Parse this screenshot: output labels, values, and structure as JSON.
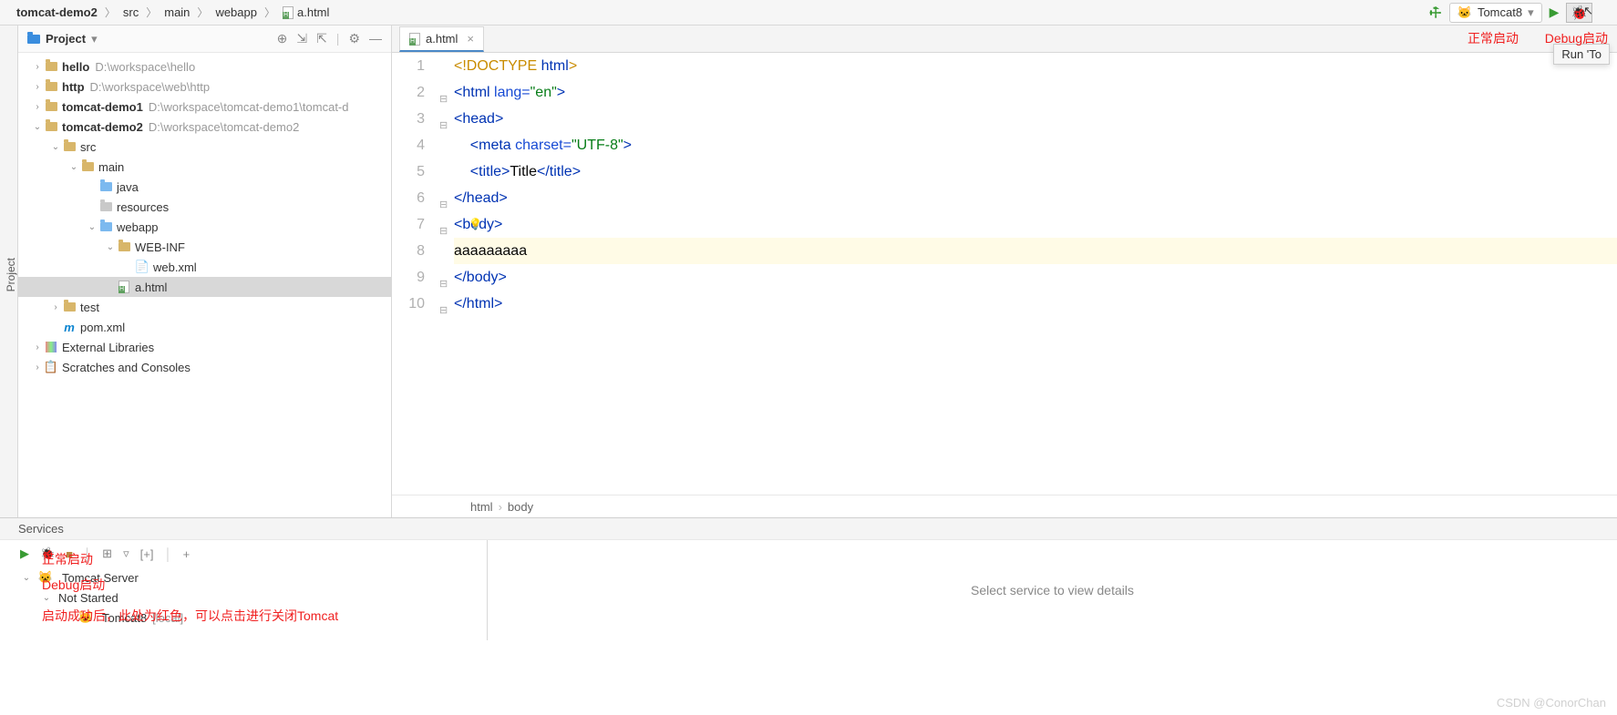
{
  "breadcrumbs": [
    {
      "label": "tomcat-demo2",
      "bold": true
    },
    {
      "label": "src"
    },
    {
      "label": "main"
    },
    {
      "label": "webapp"
    },
    {
      "label": "a.html",
      "icon": "html"
    }
  ],
  "toolbar": {
    "run_config": "Tomcat8",
    "tooltip": "Run 'To"
  },
  "left_gutter": "Project",
  "project_panel": {
    "title": "Project",
    "tree": [
      {
        "indent": 0,
        "arrow": "›",
        "icon": "folder",
        "name": "hello",
        "bold": true,
        "path": "D:\\workspace\\hello"
      },
      {
        "indent": 0,
        "arrow": "›",
        "icon": "folder",
        "name": "http",
        "bold": true,
        "path": "D:\\workspace\\web\\http"
      },
      {
        "indent": 0,
        "arrow": "›",
        "icon": "folder",
        "name": "tomcat-demo1",
        "bold": true,
        "path": "D:\\workspace\\tomcat-demo1\\tomcat-d"
      },
      {
        "indent": 0,
        "arrow": "⌄",
        "icon": "folder",
        "name": "tomcat-demo2",
        "bold": true,
        "path": "D:\\workspace\\tomcat-demo2"
      },
      {
        "indent": 1,
        "arrow": "⌄",
        "icon": "folder",
        "name": "src"
      },
      {
        "indent": 2,
        "arrow": "⌄",
        "icon": "folder",
        "name": "main"
      },
      {
        "indent": 3,
        "arrow": "",
        "icon": "folder-blue",
        "name": "java"
      },
      {
        "indent": 3,
        "arrow": "",
        "icon": "folder-gear",
        "name": "resources"
      },
      {
        "indent": 3,
        "arrow": "⌄",
        "icon": "folder-blue",
        "name": "webapp"
      },
      {
        "indent": 4,
        "arrow": "⌄",
        "icon": "folder",
        "name": "WEB-INF"
      },
      {
        "indent": 5,
        "arrow": "",
        "icon": "xml",
        "name": "web.xml"
      },
      {
        "indent": 4,
        "arrow": "",
        "icon": "html",
        "name": "a.html",
        "selected": true
      },
      {
        "indent": 1,
        "arrow": "›",
        "icon": "folder",
        "name": "test"
      },
      {
        "indent": 1,
        "arrow": "",
        "icon": "maven",
        "name": "pom.xml"
      },
      {
        "indent": 0,
        "arrow": "›",
        "icon": "lib",
        "name": "External Libraries"
      },
      {
        "indent": 0,
        "arrow": "›",
        "icon": "scratch",
        "name": "Scratches and Consoles"
      }
    ]
  },
  "editor": {
    "tab": "a.html",
    "lines": [
      {
        "n": 1,
        "html": "<span class='tk-doctype'>&lt;!DOCTYPE <span class='tk-tag'>html</span>&gt;</span>",
        "fold": ""
      },
      {
        "n": 2,
        "html": "<span class='tk-tag'>&lt;html</span> <span class='tk-attr'>lang=</span><span class='tk-str'>\"en\"</span><span class='tk-tag'>&gt;</span>",
        "fold": "⊟"
      },
      {
        "n": 3,
        "html": "<span class='tk-tag'>&lt;head&gt;</span>",
        "fold": "⊟"
      },
      {
        "n": 4,
        "html": "&nbsp;&nbsp;&nbsp;&nbsp;<span class='tk-tag'>&lt;meta</span> <span class='tk-attr'>charset=</span><span class='tk-str'>\"UTF-8\"</span><span class='tk-tag'>&gt;</span>"
      },
      {
        "n": 5,
        "html": "&nbsp;&nbsp;&nbsp;&nbsp;<span class='tk-tag'>&lt;title&gt;</span><span class='tk-plain'>Title</span><span class='tk-tag'>&lt;/title&gt;</span>"
      },
      {
        "n": 6,
        "html": "<span class='tk-tag'>&lt;/head&gt;</span>",
        "fold": "⊟"
      },
      {
        "n": 7,
        "html": "<span class='tk-tag'>&lt;<span class='bulb'>💡</span>body&gt;</span>",
        "fold": "⊟"
      },
      {
        "n": 8,
        "html": "<span class='tk-plain'>aaaaaaaaa</span>",
        "hl": true
      },
      {
        "n": 9,
        "html": "<span class='tk-tag'>&lt;/body&gt;</span>",
        "fold": "⊟"
      },
      {
        "n": 10,
        "html": "<span class='tk-tag'>&lt;/html&gt;</span>",
        "fold": "⊟"
      }
    ],
    "crumbs": [
      "html",
      "body"
    ]
  },
  "services": {
    "title": "Services",
    "tree": [
      {
        "indent": 0,
        "arrow": "⌄",
        "icon": "tomcat",
        "name": "Tomcat Server"
      },
      {
        "indent": 1,
        "arrow": "⌄",
        "icon": "",
        "name": "Not Started"
      },
      {
        "indent": 2,
        "arrow": "",
        "icon": "tomcat",
        "name": "Tomcat8",
        "suffix": "[local]"
      }
    ],
    "details": "Select service to view details"
  },
  "annotations": {
    "normal_start_top": "正常启动",
    "debug_start_top": "Debug启动",
    "normal_start": "正常启动",
    "debug_start": "Debug启动",
    "after_start": "启动成功后，此处为红色，可以点击进行关闭Tomcat"
  },
  "watermark": "CSDN @ConorChan"
}
